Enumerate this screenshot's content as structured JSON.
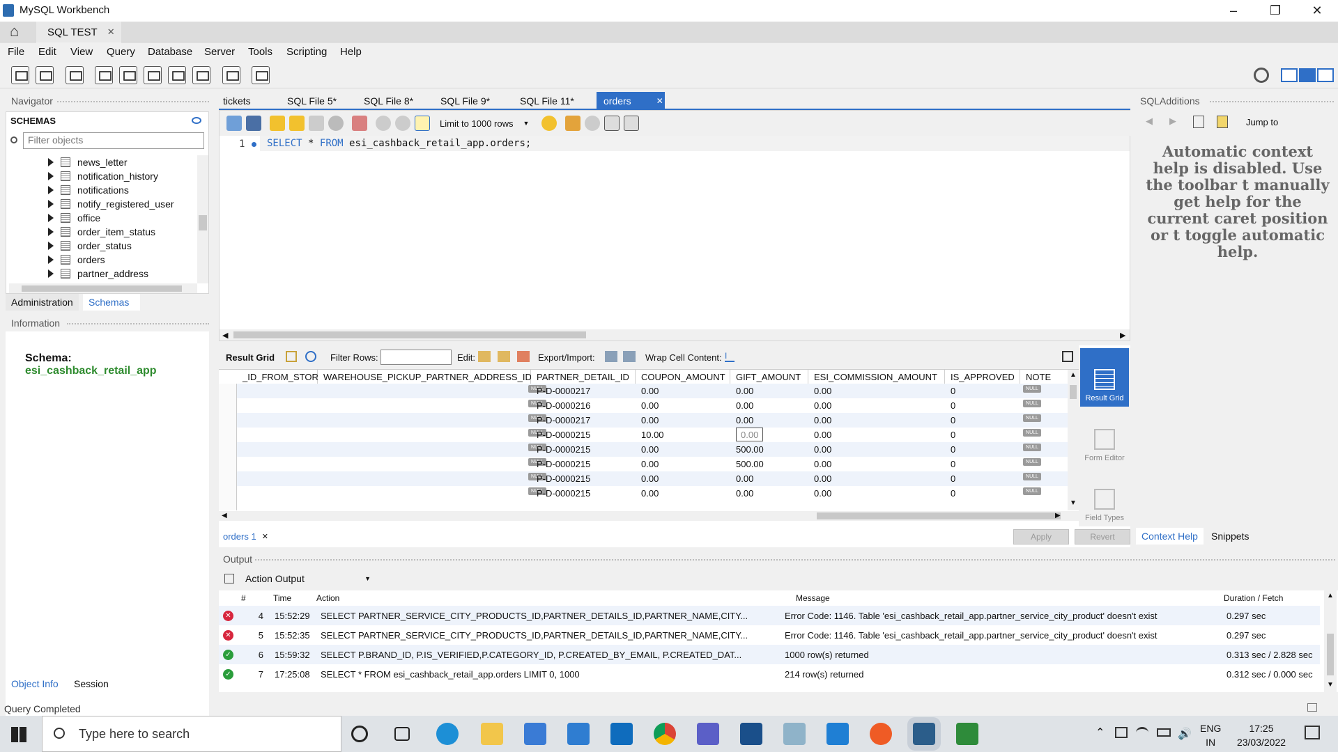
{
  "window": {
    "title": "MySQL Workbench"
  },
  "connection_tab": {
    "label": "SQL TEST"
  },
  "menu": [
    "File",
    "Edit",
    "View",
    "Query",
    "Database",
    "Server",
    "Tools",
    "Scripting",
    "Help"
  ],
  "navigator": {
    "title": "Navigator",
    "schemas_header": "SCHEMAS",
    "filter_placeholder": "Filter objects",
    "tables": [
      "news_letter",
      "notification_history",
      "notifications",
      "notify_registered_user",
      "office",
      "order_item_status",
      "order_status",
      "orders",
      "partner_address"
    ],
    "tabs": [
      "Administration",
      "Schemas"
    ],
    "info_title": "Information",
    "schema_label": "Schema:",
    "schema_name": "esi_cashback_retail_app",
    "bottom_tabs": [
      "Object Info",
      "Session"
    ]
  },
  "editor": {
    "tabs": [
      "tickets",
      "SQL File 5*",
      "SQL File 8*",
      "SQL File 9*",
      "SQL File 11*",
      "orders"
    ],
    "limit": "Limit to 1000 rows",
    "line_no": "1",
    "sql_keywords": [
      "SELECT",
      "FROM"
    ],
    "sql_star": "*",
    "sql_table": "esi_cashback_retail_app.orders;"
  },
  "result": {
    "result_grid": "Result Grid",
    "filter_rows": "Filter Rows:",
    "edit": "Edit:",
    "export_import": "Export/Import:",
    "wrap": "Wrap Cell Content:",
    "columns": [
      "_ID_FROM_STORE",
      "WAREHOUSE_PICKUP_PARTNER_ADDRESS_ID",
      "PARTNER_DETAIL_ID",
      "COUPON_AMOUNT",
      "GIFT_AMOUNT",
      "ESI_COMMISSION_AMOUNT",
      "IS_APPROVED",
      "NOTE"
    ],
    "null_label": "NULL",
    "rows": [
      [
        "P-D-0000217",
        "0.00",
        "0.00",
        "0.00",
        "0"
      ],
      [
        "P-D-0000216",
        "0.00",
        "0.00",
        "0.00",
        "0"
      ],
      [
        "P-D-0000217",
        "0.00",
        "0.00",
        "0.00",
        "0"
      ],
      [
        "P-D-0000215",
        "10.00",
        "0.00",
        "0.00",
        "0"
      ],
      [
        "P-D-0000215",
        "0.00",
        "500.00",
        "0.00",
        "0"
      ],
      [
        "P-D-0000215",
        "0.00",
        "500.00",
        "0.00",
        "0"
      ],
      [
        "P-D-0000215",
        "0.00",
        "0.00",
        "0.00",
        "0"
      ],
      [
        "P-D-0000215",
        "0.00",
        "0.00",
        "0.00",
        "0"
      ]
    ],
    "side": [
      "Result Grid",
      "Form Editor",
      "Field Types"
    ],
    "result_tab": "orders 1",
    "apply": "Apply",
    "revert": "Revert"
  },
  "sql_additions": {
    "title": "SQLAdditions",
    "jump_to": "Jump to",
    "help_text": "Automatic context help is disabled. Use the toolbar t manually get help for the current caret position or t toggle automatic help.",
    "tabs": [
      "Context Help",
      "Snippets"
    ]
  },
  "output": {
    "title": "Output",
    "selector": "Action Output",
    "headers": [
      "#",
      "Time",
      "Action",
      "Message",
      "Duration / Fetch"
    ],
    "rows": [
      {
        "status": "error",
        "n": "4",
        "time": "15:52:29",
        "action": "SELECT PARTNER_SERVICE_CITY_PRODUCTS_ID,PARTNER_DETAILS_ID,PARTNER_NAME,CITY...",
        "message": "Error Code: 1146. Table 'esi_cashback_retail_app.partner_service_city_product' doesn't exist",
        "duration": "0.297 sec"
      },
      {
        "status": "error",
        "n": "5",
        "time": "15:52:35",
        "action": "SELECT PARTNER_SERVICE_CITY_PRODUCTS_ID,PARTNER_DETAILS_ID,PARTNER_NAME,CITY...",
        "message": "Error Code: 1146. Table 'esi_cashback_retail_app.partner_service_city_product' doesn't exist",
        "duration": "0.297 sec"
      },
      {
        "status": "ok",
        "n": "6",
        "time": "15:59:32",
        "action": "SELECT P.BRAND_ID, P.IS_VERIFIED,P.CATEGORY_ID, P.CREATED_BY_EMAIL, P.CREATED_DAT...",
        "message": "1000 row(s) returned",
        "duration": "0.313 sec / 2.828 sec"
      },
      {
        "status": "ok",
        "n": "7",
        "time": "17:25:08",
        "action": "SELECT * FROM esi_cashback_retail_app.orders LIMIT 0, 1000",
        "message": "214 row(s) returned",
        "duration": "0.312 sec / 0.000 sec"
      }
    ]
  },
  "status": "Query Completed",
  "taskbar": {
    "search": "Type here to search",
    "lang1": "ENG",
    "lang2": "IN",
    "time": "17:25",
    "date": "23/03/2022"
  },
  "colors": {
    "accent": "#1e73be",
    "selected_tab": "#2f6fc7",
    "error": "#d7263d",
    "ok": "#2a9d3b",
    "green_schema": "#2e8b2e"
  }
}
